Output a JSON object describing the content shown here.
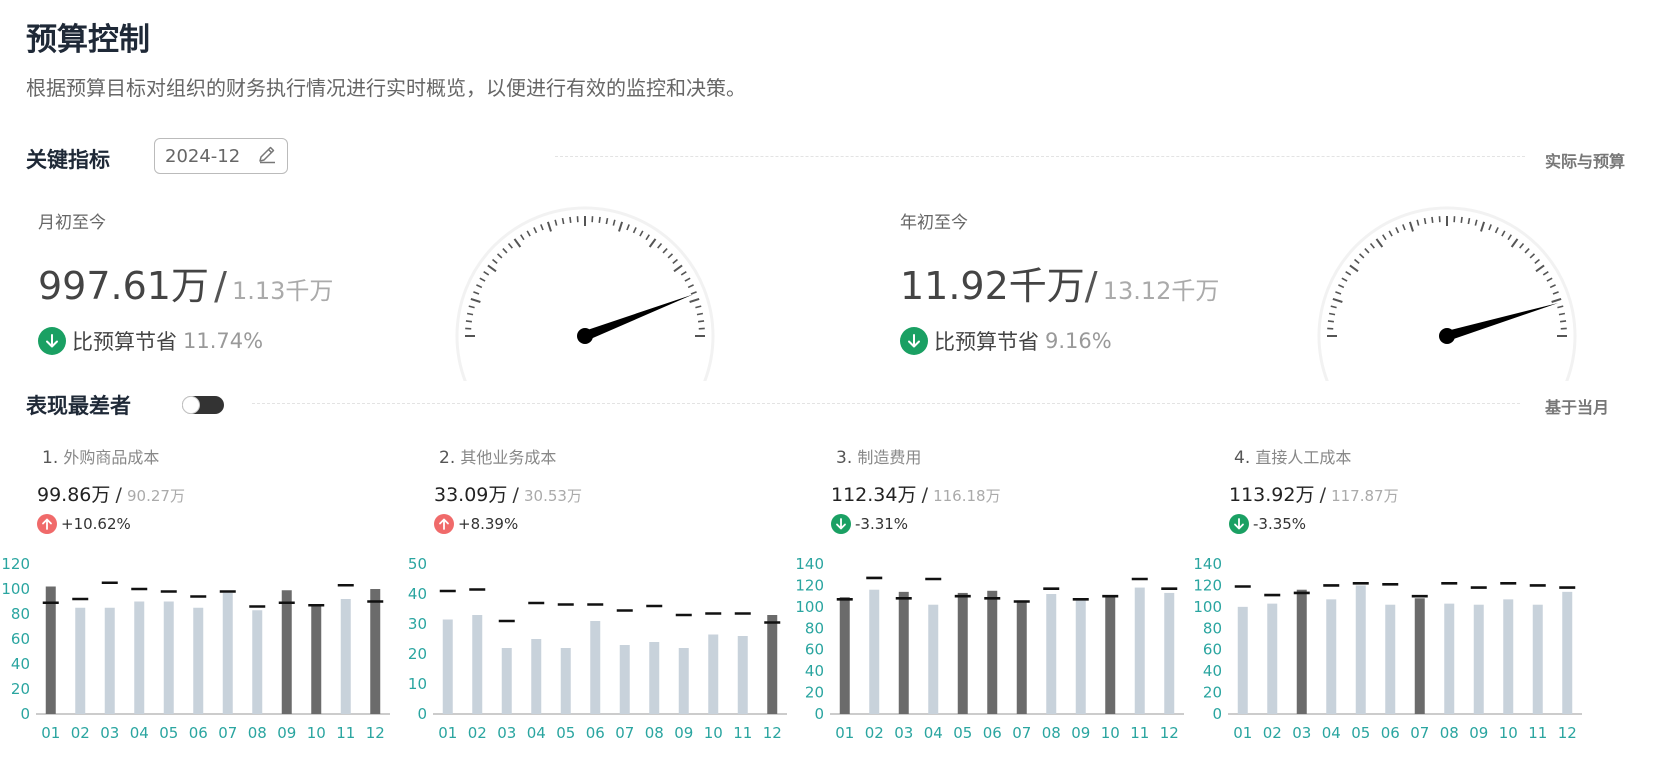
{
  "header": {
    "title": "预算控制",
    "subtitle": "根据预算目标对组织的财务执行情况进行实时概览，以便进行有效的监控和决策。"
  },
  "key_metrics": {
    "title": "关键指标",
    "period": "2024-12",
    "right_label": "实际与预算",
    "mtd": {
      "label": "月初至今",
      "actual": "997.61万",
      "slash": "/",
      "budget": "1.13千万",
      "status_text": "比预算节省",
      "status_pct": "11.74%",
      "gauge_fraction": 0.883
    },
    "ytd": {
      "label": "年初至今",
      "actual": "11.92千万",
      "slash": "/",
      "budget": "13.12千万",
      "status_text": "比预算节省",
      "status_pct": "9.16%",
      "gauge_fraction": 0.908
    }
  },
  "worst": {
    "title": "表现最差者",
    "right_label": "基于当月",
    "toggle_on": true
  },
  "colors": {
    "up": "#f06a6a",
    "down": "#1aa063",
    "bar_highlight": "#6b6b6b",
    "bar_normal": "#c8d2db",
    "axis_text": "#2aa5a0",
    "budget_mark": "#111111"
  },
  "chart_data": [
    {
      "type": "bar",
      "rank": "1.",
      "name": "外购商品成本",
      "actual": "99.86万",
      "slash": "/",
      "budget": "90.27万",
      "change": "+10.62%",
      "direction": "up",
      "categories": [
        "01",
        "02",
        "03",
        "04",
        "05",
        "06",
        "07",
        "08",
        "09",
        "10",
        "11",
        "12"
      ],
      "actual_values": [
        102,
        85,
        85,
        90,
        90,
        85,
        97,
        83,
        99,
        87,
        92,
        100
      ],
      "budget_values": [
        89,
        92,
        105,
        100,
        98,
        94,
        98,
        86,
        89,
        87,
        103,
        90
      ],
      "highlight": [
        true,
        false,
        false,
        false,
        false,
        false,
        false,
        false,
        true,
        true,
        false,
        true
      ],
      "ylim": [
        0,
        120
      ],
      "yticks": [
        0,
        20,
        40,
        60,
        80,
        100,
        120
      ]
    },
    {
      "type": "bar",
      "rank": "2.",
      "name": "其他业务成本",
      "actual": "33.09万",
      "slash": "/",
      "budget": "30.53万",
      "change": "+8.39%",
      "direction": "up",
      "categories": [
        "01",
        "02",
        "03",
        "04",
        "05",
        "06",
        "07",
        "08",
        "09",
        "10",
        "11",
        "12"
      ],
      "actual_values": [
        31.5,
        33,
        22,
        25,
        22,
        31,
        23,
        24,
        22,
        26.5,
        26,
        33
      ],
      "budget_values": [
        41,
        41.5,
        31,
        37,
        36.5,
        36.5,
        34.5,
        36,
        33,
        33.5,
        33.5,
        30.5
      ],
      "highlight": [
        false,
        false,
        false,
        false,
        false,
        false,
        false,
        false,
        false,
        false,
        false,
        true
      ],
      "ylim": [
        0,
        50
      ],
      "yticks": [
        0,
        10,
        20,
        30,
        40,
        50
      ]
    },
    {
      "type": "bar",
      "rank": "3.",
      "name": "制造费用",
      "actual": "112.34万",
      "slash": "/",
      "budget": "116.18万",
      "change": "-3.31%",
      "direction": "down",
      "categories": [
        "01",
        "02",
        "03",
        "04",
        "05",
        "06",
        "07",
        "08",
        "09",
        "10",
        "11",
        "12"
      ],
      "actual_values": [
        109,
        116,
        114,
        102,
        113,
        115,
        106,
        112,
        106,
        111,
        118,
        113
      ],
      "budget_values": [
        107,
        127,
        108,
        126,
        110,
        108,
        105,
        117,
        107,
        110,
        126,
        117
      ],
      "highlight": [
        true,
        false,
        true,
        false,
        true,
        true,
        true,
        false,
        false,
        true,
        false,
        false
      ],
      "ylim": [
        0,
        140
      ],
      "yticks": [
        0,
        20,
        40,
        60,
        80,
        100,
        120,
        140
      ]
    },
    {
      "type": "bar",
      "rank": "4.",
      "name": "直接人工成本",
      "actual": "113.92万",
      "slash": "/",
      "budget": "117.87万",
      "change": "-3.35%",
      "direction": "down",
      "categories": [
        "01",
        "02",
        "03",
        "04",
        "05",
        "06",
        "07",
        "08",
        "09",
        "10",
        "11",
        "12"
      ],
      "actual_values": [
        100,
        103,
        116,
        107,
        120,
        102,
        108,
        103,
        102,
        107,
        102,
        114
      ],
      "budget_values": [
        119,
        111,
        113,
        120,
        122,
        121,
        110,
        122,
        118,
        122,
        120,
        118
      ],
      "highlight": [
        false,
        false,
        true,
        false,
        false,
        false,
        true,
        false,
        false,
        false,
        false,
        false
      ],
      "ylim": [
        0,
        140
      ],
      "yticks": [
        0,
        20,
        40,
        60,
        80,
        100,
        120,
        140
      ]
    }
  ]
}
